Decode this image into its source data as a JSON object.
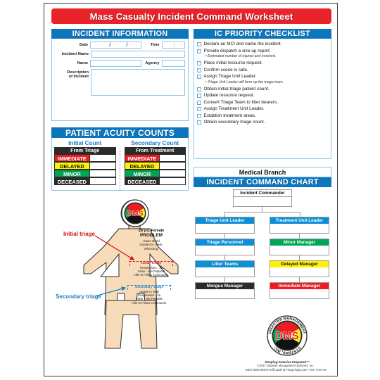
{
  "document": {
    "title": "Mass Casualty Incident Command Worksheet"
  },
  "incident_information": {
    "header": "INCIDENT INFORMATION",
    "fields": {
      "date_label": "Date",
      "date_value": "",
      "date_separator": "/",
      "time_label": "Time",
      "time_value": "",
      "time_separator": ":",
      "incident_name_label": "Incident Name",
      "incident_name_value": "",
      "name_label": "Name",
      "name_value": "",
      "agency_label": "Agency",
      "agency_value": "",
      "description_label_line1": "Description",
      "description_label_line2": "of Incident",
      "description_value": ""
    }
  },
  "patient_acuity": {
    "header": "PATIENT ACUITY COUNTS",
    "columns": [
      {
        "title": "Initial Count",
        "subtitle": "From Triage",
        "rows": [
          {
            "label": "IMMEDIATE",
            "color": "#ec1c24",
            "text_color": "#ffffff",
            "count": ""
          },
          {
            "label": "DELAYED",
            "color": "#fff200",
            "text_color": "#111111",
            "count": ""
          },
          {
            "label": "MINOR",
            "color": "#00a651",
            "text_color": "#ffffff",
            "count": ""
          },
          {
            "label": "DECEASED",
            "color": "#2b2b2b",
            "text_color": "#ffffff",
            "count": ""
          }
        ]
      },
      {
        "title": "Secondary Count",
        "subtitle": "From Treatment",
        "rows": [
          {
            "label": "IMMEDIATE",
            "color": "#ec1c24",
            "text_color": "#ffffff",
            "count": ""
          },
          {
            "label": "DELAYED",
            "color": "#fff200",
            "text_color": "#111111",
            "count": ""
          },
          {
            "label": "MINOR",
            "color": "#00a651",
            "text_color": "#ffffff",
            "count": ""
          },
          {
            "label": "DECEASED",
            "color": "#2b2b2b",
            "text_color": "#ffffff",
            "count": ""
          }
        ]
      }
    ]
  },
  "checklist": {
    "header": "IC PRIORITY CHECKLIST",
    "items": [
      {
        "text": "Declare an MCI and name the incident.",
        "note": null
      },
      {
        "text": "Provide dispatch a size-up report.",
        "note": "• Estimated number of injured and involved."
      },
      {
        "text": "Place initial resource request.",
        "note": null
      },
      {
        "text": "Confirm scene is safe.",
        "note": null
      },
      {
        "text": "Assign Triage Unit Leader.",
        "note": "• Triage Unit Leader will form up the triage team."
      },
      {
        "text": "Obtain initial triage patient count.",
        "note": null
      },
      {
        "text": "Update resource request.",
        "note": null
      },
      {
        "text": "Convert Triage Team to litter bearers.",
        "note": null
      },
      {
        "text": "Assign Treatment Unit Leader.",
        "note": null
      },
      {
        "text": "Establish treatment areas.",
        "note": null
      },
      {
        "text": "Obtain secondary triage count.",
        "note": null
      }
    ]
  },
  "command_chart": {
    "medical_branch": "Medical Branch",
    "header": "INCIDENT COMMAND CHART",
    "commander": {
      "label": "Incident Commander",
      "color": "#ffffff",
      "text_color": "#111111"
    },
    "left_column": [
      {
        "label": "Triage Unit Leader",
        "color": "#0c8fd6",
        "text_color": "#ffffff"
      },
      {
        "label": "Triage Personnel",
        "color": "#0c8fd6",
        "text_color": "#ffffff"
      },
      {
        "label": "Litter Teams",
        "color": "#0c8fd6",
        "text_color": "#ffffff"
      },
      {
        "label": "Morgue Manager",
        "color": "#2b2b2b",
        "text_color": "#ffffff"
      }
    ],
    "right_column": [
      {
        "label": "Treatment Unit Leader",
        "color": "#0c8fd6",
        "text_color": "#ffffff"
      },
      {
        "label": "Minor Manager",
        "color": "#00a651",
        "text_color": "#ffffff"
      },
      {
        "label": "Delayed Manager",
        "color": "#fff200",
        "text_color": "#111111"
      },
      {
        "label": "Immediate Manager",
        "color": "#ec1c24",
        "text_color": "#ffffff"
      }
    ]
  },
  "figure": {
    "callout_initial": "Initial triage",
    "callout_secondary": "Secondary triage",
    "patient_age": "28 y.o. Female",
    "problem_heading": "PROBLEM",
    "problem_line1": "Glass shard",
    "problem_line2": "impaled in chest.",
    "problem_line3": "Wheezing.",
    "initial_triage": {
      "heading": "Initial Triage",
      "lines": [
        "Respirations - 15",
        "Pulse - Not Palpable",
        "Able to Follow Commands."
      ]
    },
    "secondary_triage": {
      "heading": "Secondary Triage",
      "lines": [
        "Unable to Walk",
        "Respirations - 15",
        "Pulse - Not Palpable",
        "Able to Follow Commands."
      ]
    }
  },
  "logo": {
    "ring_top": "DISASTER MANAGEMENT",
    "ring_bottom": "SYSTEMS, INC.",
    "monogram": "DMS",
    "tagline": "Keeping America Prepared™"
  },
  "footer": {
    "line1": "©2017 Disaster Management Systems, Inc.",
    "line2": "order DMS-05079 refill pads at TriageTags.com • Rev. 9-25-18"
  }
}
